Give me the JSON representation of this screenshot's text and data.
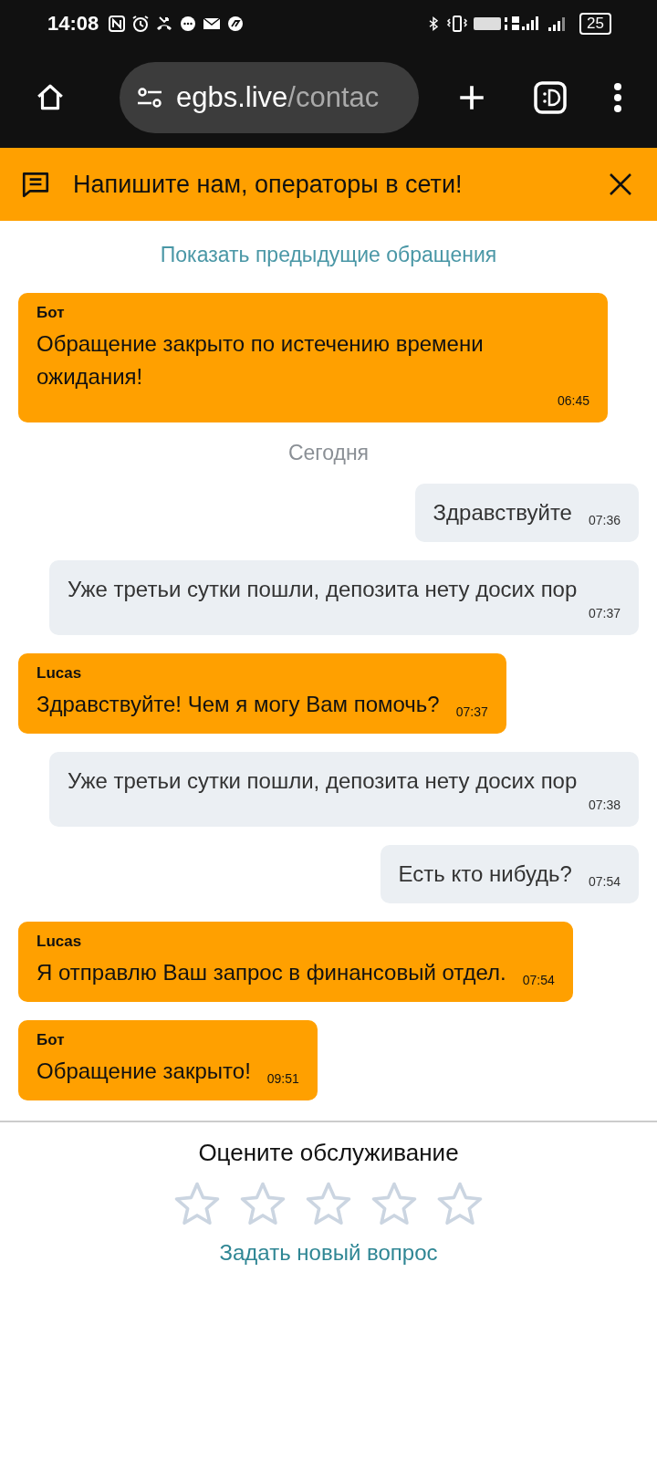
{
  "status_bar": {
    "time": "14:08",
    "battery": "25"
  },
  "browser": {
    "url_host": "egbs.live",
    "url_path": "/contac"
  },
  "banner": {
    "text": "Напишите нам, операторы в сети!"
  },
  "show_previous": "Показать предыдущие обращения",
  "messages": [
    {
      "kind": "agent",
      "author": "Бот",
      "text": "Обращение закрыто по истечению времени ожидания!",
      "time": "06:45"
    },
    {
      "kind": "date",
      "text": "Сегодня"
    },
    {
      "kind": "user",
      "text": "Здравствуйте",
      "time": "07:36"
    },
    {
      "kind": "user",
      "text": "Уже третьи сутки пошли, депозита нету досих пор",
      "time": "07:37"
    },
    {
      "kind": "agent",
      "author": "Lucas",
      "text": "Здравствуйте! Чем я могу Вам помочь?",
      "time": "07:37"
    },
    {
      "kind": "user",
      "text": "Уже третьи сутки пошли, депозита нету досих пор",
      "time": "07:38"
    },
    {
      "kind": "user",
      "text": "Есть кто нибудь?",
      "time": "07:54"
    },
    {
      "kind": "agent",
      "author": "Lucas",
      "text": "Я отправлю Ваш запрос в финансовый отдел.",
      "time": "07:54"
    },
    {
      "kind": "agent",
      "author": "Бот",
      "text": "Обращение закрыто!",
      "time": "09:51"
    }
  ],
  "rating": {
    "title": "Оцените обслуживание",
    "stars": 0
  },
  "new_question": "Задать новый вопрос"
}
